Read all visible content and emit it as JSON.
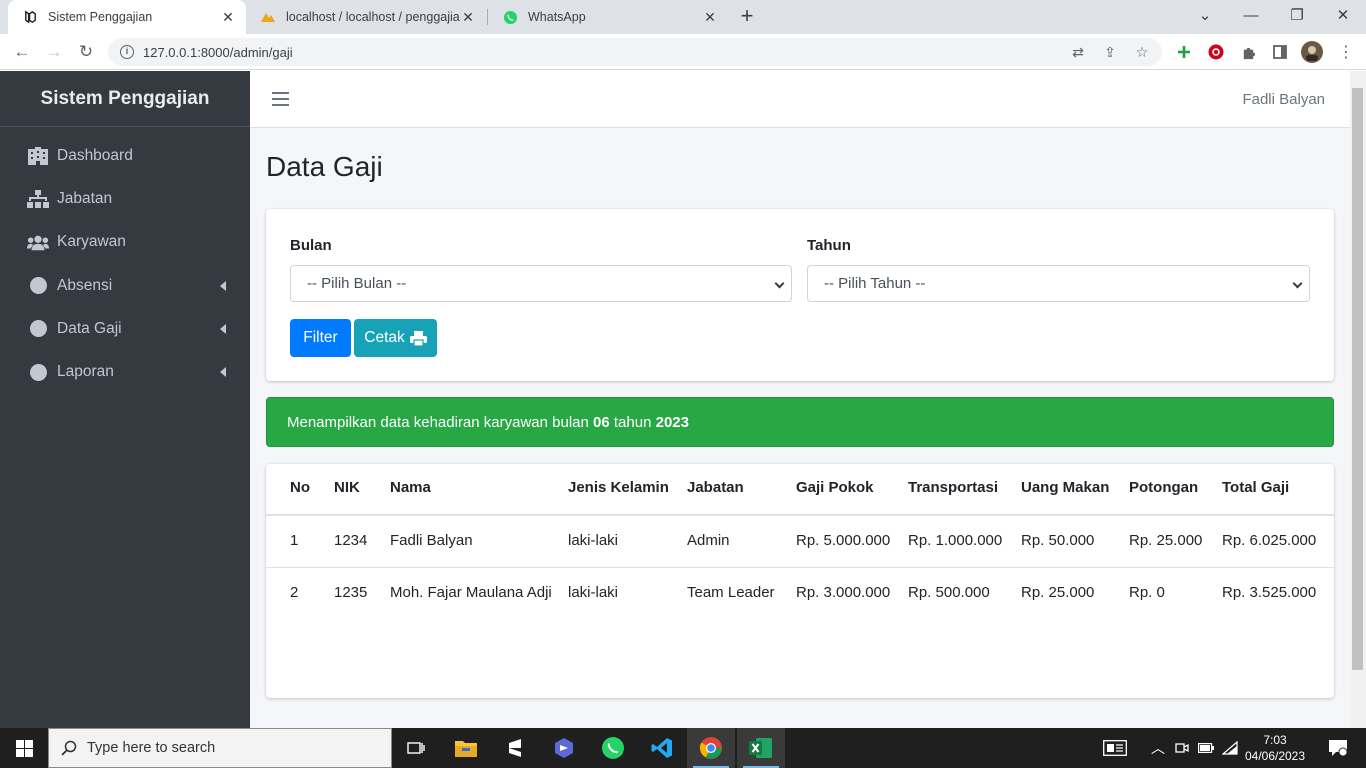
{
  "browser": {
    "tabs": [
      {
        "title": "Sistem Penggajian",
        "active": true
      },
      {
        "title": "localhost / localhost / penggajian",
        "active": false
      },
      {
        "title": "WhatsApp",
        "active": false
      }
    ],
    "url": "127.0.0.1:8000/admin/gaji"
  },
  "sidebar": {
    "brand": "Sistem Penggajian",
    "items": [
      {
        "label": "Dashboard",
        "icon": "building-icon",
        "has_children": false
      },
      {
        "label": "Jabatan",
        "icon": "sitemap-icon",
        "has_children": false
      },
      {
        "label": "Karyawan",
        "icon": "users-icon",
        "has_children": false
      },
      {
        "label": "Absensi",
        "icon": "circle-icon",
        "has_children": true
      },
      {
        "label": "Data Gaji",
        "icon": "circle-icon",
        "has_children": true
      },
      {
        "label": "Laporan",
        "icon": "circle-icon",
        "has_children": true
      }
    ]
  },
  "topnav": {
    "user": "Fadli Balyan"
  },
  "page": {
    "title": "Data Gaji"
  },
  "filter": {
    "bulan_label": "Bulan",
    "bulan_value": "-- Pilih Bulan --",
    "tahun_label": "Tahun",
    "tahun_value": "-- Pilih Tahun --",
    "filter_button": "Filter",
    "cetak_button": "Cetak"
  },
  "alert": {
    "prefix": "Menampilkan data kehadiran karyawan bulan",
    "month": "06",
    "middle": "tahun",
    "year": "2023"
  },
  "table": {
    "headers": {
      "no": "No",
      "nik": "NIK",
      "nama": "Nama",
      "jenis_kelamin": "Jenis Kelamin",
      "jabatan": "Jabatan",
      "gaji_pokok": "Gaji Pokok",
      "transportasi": "Transportasi",
      "uang_makan": "Uang Makan",
      "potongan": "Potongan",
      "total_gaji": "Total Gaji"
    },
    "rows": [
      {
        "no": "1",
        "nik": "1234",
        "nama": "Fadli Balyan",
        "jenis_kelamin": "laki-laki",
        "jabatan": "Admin",
        "gaji_pokok": "Rp. 5.000.000",
        "transportasi": "Rp. 1.000.000",
        "uang_makan": "Rp. 50.000",
        "potongan": "Rp. 25.000",
        "total_gaji": "Rp. 6.025.000"
      },
      {
        "no": "2",
        "nik": "1235",
        "nama": "Moh. Fajar Maulana Adji",
        "jenis_kelamin": "laki-laki",
        "jabatan": "Team Leader",
        "gaji_pokok": "Rp. 3.000.000",
        "transportasi": "Rp. 500.000",
        "uang_makan": "Rp. 25.000",
        "potongan": "Rp. 0",
        "total_gaji": "Rp. 3.525.000"
      }
    ]
  },
  "taskbar": {
    "search_placeholder": "Type here to search",
    "time": "7:03",
    "date": "04/06/2023"
  },
  "colors": {
    "sidebar_bg": "#343a40",
    "primary": "#007bff",
    "info": "#17a2b8",
    "success": "#28a745"
  }
}
